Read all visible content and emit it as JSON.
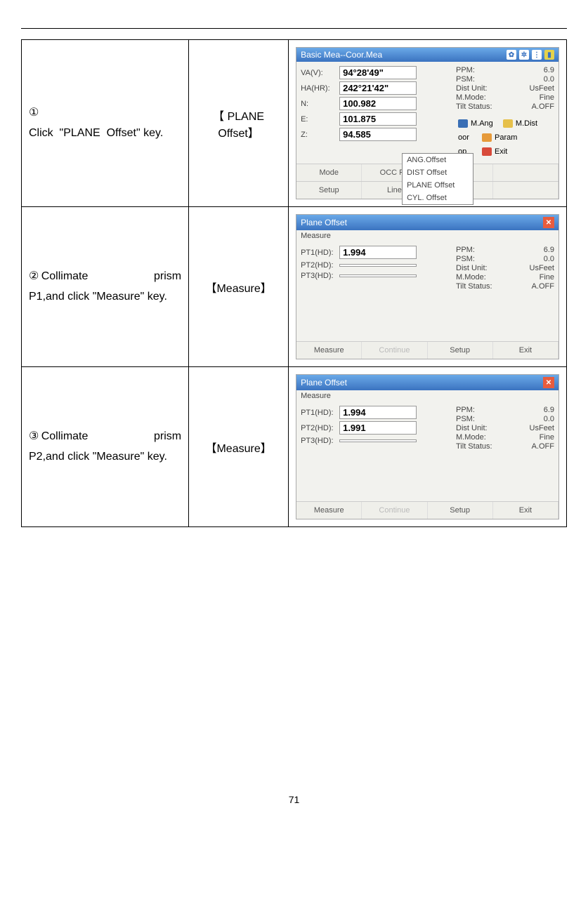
{
  "page_number": "71",
  "rows": [
    {
      "step_text": "①\nClick \"PLANE Offset\" key.",
      "action_text": "【 PLANE Offset】",
      "screenshot": {
        "title": "Basic Mea--Coor.Mea",
        "fields": [
          {
            "label": "VA(V):",
            "value": "94°28'49\""
          },
          {
            "label": "HA(HR):",
            "value": "242°21'42\""
          },
          {
            "label": "N:",
            "value": "100.982"
          },
          {
            "label": "E:",
            "value": "101.875"
          },
          {
            "label": "Z:",
            "value": "94.585"
          }
        ],
        "info": [
          {
            "label": "PPM:",
            "value": "6.9"
          },
          {
            "label": "PSM:",
            "value": "0.0"
          },
          {
            "label": "Dist Unit:",
            "value": "UsFeet"
          },
          {
            "label": "M.Mode:",
            "value": "Fine"
          },
          {
            "label": "Tilt Status:",
            "value": "A.OFF"
          }
        ],
        "side_buttons": [
          {
            "label": "M.Ang",
            "color": "#3a6fb5"
          },
          {
            "label": "M.Dist",
            "color": "#e6c04a"
          },
          {
            "label": "Param",
            "color": "#e69a3a"
          },
          {
            "label": "Exit",
            "color": "#d84a3a"
          }
        ],
        "popup": [
          "ANG.Offset",
          "DIST Offset",
          "PLANE Offset",
          "CYL. Offset"
        ],
        "bottom": [
          "Mode",
          "OCC PT",
          "",
          "oor",
          "",
          "op"
        ],
        "bottom_main": [
          "Mode",
          "OCC PT"
        ],
        "bottom_sub": [
          "Setup",
          "Line"
        ],
        "coor_label": "oor",
        "op_label": "op"
      }
    },
    {
      "step_text": "②Collimate prism P1,and click \"Measure\" key.",
      "action_text": "【Measure】",
      "screenshot": {
        "title": "Plane Offset",
        "section": "Measure",
        "fields": [
          {
            "label": "PT1(HD):",
            "value": "1.994"
          },
          {
            "label": "PT2(HD):",
            "value": ""
          },
          {
            "label": "PT3(HD):",
            "value": ""
          }
        ],
        "info": [
          {
            "label": "PPM:",
            "value": "6.9"
          },
          {
            "label": "PSM:",
            "value": "0.0"
          },
          {
            "label": "Dist Unit:",
            "value": "UsFeet"
          },
          {
            "label": "M.Mode:",
            "value": "Fine"
          },
          {
            "label": "Tilt Status:",
            "value": "A.OFF"
          }
        ],
        "bottom": [
          "Measure",
          "Continue",
          "Setup",
          "Exit"
        ]
      }
    },
    {
      "step_text": "③Collimate prism P2,and click \"Measure\" key.",
      "action_text": "【Measure】",
      "screenshot": {
        "title": "Plane Offset",
        "section": "Measure",
        "fields": [
          {
            "label": "PT1(HD):",
            "value": "1.994"
          },
          {
            "label": "PT2(HD):",
            "value": "1.991"
          },
          {
            "label": "PT3(HD):",
            "value": ""
          }
        ],
        "info": [
          {
            "label": "PPM:",
            "value": "6.9"
          },
          {
            "label": "PSM:",
            "value": "0.0"
          },
          {
            "label": "Dist Unit:",
            "value": "UsFeet"
          },
          {
            "label": "M.Mode:",
            "value": "Fine"
          },
          {
            "label": "Tilt Status:",
            "value": "A.OFF"
          }
        ],
        "bottom": [
          "Measure",
          "Continue",
          "Setup",
          "Exit"
        ]
      }
    }
  ]
}
